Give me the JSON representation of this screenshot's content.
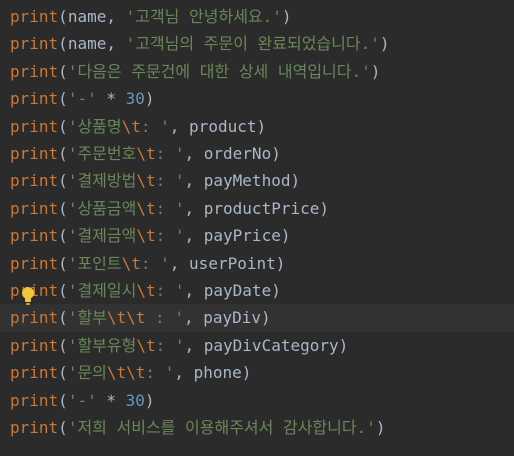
{
  "colors": {
    "background": "#2b2b2b",
    "current_line": "#323232",
    "keyword": "#cc7832",
    "string": "#6a8759",
    "number": "#6897bb",
    "text": "#a9b7c6",
    "bulb": "#f0c43c"
  },
  "icons": {
    "gutter_hint": "lightbulb-icon"
  },
  "lines": [
    {
      "t": [
        {
          "c": "fn",
          "v": "print"
        },
        {
          "c": "punc",
          "v": "("
        },
        {
          "c": "id",
          "v": "name, "
        },
        {
          "c": "str",
          "v": "'고객님 안녕하세요.'"
        },
        {
          "c": "punc",
          "v": ")"
        }
      ]
    },
    {
      "t": [
        {
          "c": "fn",
          "v": "print"
        },
        {
          "c": "punc",
          "v": "("
        },
        {
          "c": "id",
          "v": "name, "
        },
        {
          "c": "str",
          "v": "'고객님의 주문이 완료되었습니다.'"
        },
        {
          "c": "punc",
          "v": ")"
        }
      ]
    },
    {
      "t": [
        {
          "c": "fn",
          "v": "print"
        },
        {
          "c": "punc",
          "v": "("
        },
        {
          "c": "str",
          "v": "'다음은 주문건에 대한 상세 내역입니다.'"
        },
        {
          "c": "punc",
          "v": ")"
        }
      ]
    },
    {
      "t": [
        {
          "c": "fn",
          "v": "print"
        },
        {
          "c": "punc",
          "v": "("
        },
        {
          "c": "str",
          "v": "'-'"
        },
        {
          "c": "id",
          "v": " * "
        },
        {
          "c": "num",
          "v": "30"
        },
        {
          "c": "punc",
          "v": ")"
        }
      ]
    },
    {
      "t": [
        {
          "c": "fn",
          "v": "print"
        },
        {
          "c": "punc",
          "v": "("
        },
        {
          "c": "str",
          "v": "'상품명"
        },
        {
          "c": "esc",
          "v": "\\t"
        },
        {
          "c": "str",
          "v": ": '"
        },
        {
          "c": "id",
          "v": ", product"
        },
        {
          "c": "punc",
          "v": ")"
        }
      ]
    },
    {
      "t": [
        {
          "c": "fn",
          "v": "print"
        },
        {
          "c": "punc",
          "v": "("
        },
        {
          "c": "str",
          "v": "'주문번호"
        },
        {
          "c": "esc",
          "v": "\\t"
        },
        {
          "c": "str",
          "v": ": '"
        },
        {
          "c": "id",
          "v": ", orderNo"
        },
        {
          "c": "punc",
          "v": ")"
        }
      ]
    },
    {
      "t": [
        {
          "c": "fn",
          "v": "print"
        },
        {
          "c": "punc",
          "v": "("
        },
        {
          "c": "str",
          "v": "'결제방법"
        },
        {
          "c": "esc",
          "v": "\\t"
        },
        {
          "c": "str",
          "v": ": '"
        },
        {
          "c": "id",
          "v": ", payMethod"
        },
        {
          "c": "punc",
          "v": ")"
        }
      ]
    },
    {
      "t": [
        {
          "c": "fn",
          "v": "print"
        },
        {
          "c": "punc",
          "v": "("
        },
        {
          "c": "str",
          "v": "'상품금액"
        },
        {
          "c": "esc",
          "v": "\\t"
        },
        {
          "c": "str",
          "v": ": '"
        },
        {
          "c": "id",
          "v": ", productPrice"
        },
        {
          "c": "punc",
          "v": ")"
        }
      ]
    },
    {
      "t": [
        {
          "c": "fn",
          "v": "print"
        },
        {
          "c": "punc",
          "v": "("
        },
        {
          "c": "str",
          "v": "'결제금액"
        },
        {
          "c": "esc",
          "v": "\\t"
        },
        {
          "c": "str",
          "v": ": '"
        },
        {
          "c": "id",
          "v": ", payPrice"
        },
        {
          "c": "punc",
          "v": ")"
        }
      ]
    },
    {
      "t": [
        {
          "c": "fn",
          "v": "print"
        },
        {
          "c": "punc",
          "v": "("
        },
        {
          "c": "str",
          "v": "'포인트"
        },
        {
          "c": "esc",
          "v": "\\t"
        },
        {
          "c": "str",
          "v": ": '"
        },
        {
          "c": "id",
          "v": ", userPoint"
        },
        {
          "c": "punc",
          "v": ")"
        }
      ]
    },
    {
      "t": [
        {
          "c": "fn",
          "v": "print"
        },
        {
          "c": "punc",
          "v": "("
        },
        {
          "c": "str",
          "v": "'결제일시"
        },
        {
          "c": "esc",
          "v": "\\t"
        },
        {
          "c": "str",
          "v": ": '"
        },
        {
          "c": "id",
          "v": ", payDate"
        },
        {
          "c": "punc",
          "v": ")"
        }
      ]
    },
    {
      "t": [
        {
          "c": "fn",
          "v": "print"
        },
        {
          "c": "punc",
          "v": "("
        },
        {
          "c": "str",
          "v": "'할부"
        },
        {
          "c": "esc",
          "v": "\\t\\t"
        },
        {
          "c": "str",
          "v": " : '"
        },
        {
          "c": "id",
          "v": ", payDiv"
        },
        {
          "c": "punc",
          "v": ")"
        }
      ]
    },
    {
      "t": [
        {
          "c": "fn",
          "v": "print"
        },
        {
          "c": "punc",
          "v": "("
        },
        {
          "c": "str",
          "v": "'할부유형"
        },
        {
          "c": "esc",
          "v": "\\t"
        },
        {
          "c": "str",
          "v": ": '"
        },
        {
          "c": "id",
          "v": ", payDivCategory"
        },
        {
          "c": "punc",
          "v": ")"
        }
      ]
    },
    {
      "t": [
        {
          "c": "fn",
          "v": "print"
        },
        {
          "c": "punc",
          "v": "("
        },
        {
          "c": "str",
          "v": "'문의"
        },
        {
          "c": "esc",
          "v": "\\t\\t"
        },
        {
          "c": "str",
          "v": ": '"
        },
        {
          "c": "id",
          "v": ", phone"
        },
        {
          "c": "punc",
          "v": ")"
        }
      ]
    },
    {
      "t": [
        {
          "c": "fn",
          "v": "print"
        },
        {
          "c": "punc",
          "v": "("
        },
        {
          "c": "str",
          "v": "'-'"
        },
        {
          "c": "id",
          "v": " * "
        },
        {
          "c": "num",
          "v": "30"
        },
        {
          "c": "punc",
          "v": ")"
        }
      ]
    },
    {
      "t": [
        {
          "c": "fn",
          "v": "print"
        },
        {
          "c": "punc",
          "v": "("
        },
        {
          "c": "str",
          "v": "'저희 서비스를 이용해주셔서 감사합니다.'"
        },
        {
          "c": "punc",
          "v": ")"
        }
      ]
    }
  ],
  "current_line": 11
}
